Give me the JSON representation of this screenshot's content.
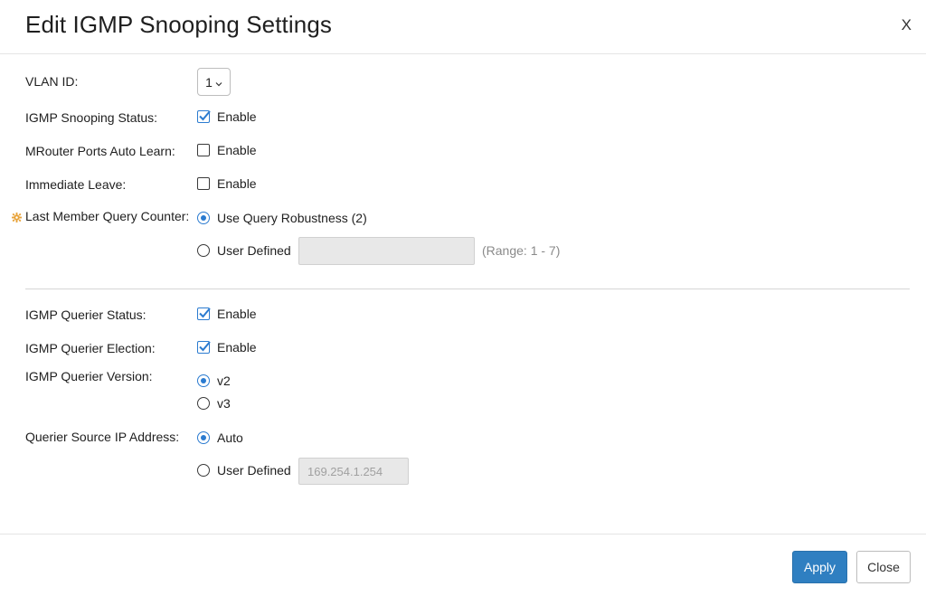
{
  "dialog": {
    "title": "Edit IGMP Snooping Settings",
    "close_glyph": "X"
  },
  "fields": {
    "vlan_id": {
      "label": "VLAN ID:",
      "value": "1"
    },
    "snooping_status": {
      "label": "IGMP Snooping Status:",
      "option": "Enable",
      "checked": true
    },
    "mrouter_auto_learn": {
      "label": "MRouter Ports Auto Learn:",
      "option": "Enable",
      "checked": false
    },
    "immediate_leave": {
      "label": "Immediate Leave:",
      "option": "Enable",
      "checked": false
    },
    "last_member_query_counter": {
      "label": "Last Member Query Counter:",
      "options": [
        {
          "label": "Use Query Robustness (2)",
          "selected": true
        },
        {
          "label": "User Defined",
          "selected": false
        }
      ],
      "user_defined_value": "",
      "range_hint": "(Range: 1 - 7)"
    },
    "querier_status": {
      "label": "IGMP Querier Status:",
      "option": "Enable",
      "checked": true
    },
    "querier_election": {
      "label": "IGMP Querier Election:",
      "option": "Enable",
      "checked": true
    },
    "querier_version": {
      "label": "IGMP Querier Version:",
      "options": [
        {
          "label": "v2",
          "selected": true
        },
        {
          "label": "v3",
          "selected": false
        }
      ]
    },
    "querier_source_ip": {
      "label": "Querier Source IP Address:",
      "options": [
        {
          "label": "Auto",
          "selected": true
        },
        {
          "label": "User Defined",
          "selected": false
        }
      ],
      "user_defined_placeholder": "169.254.1.254"
    }
  },
  "buttons": {
    "apply": "Apply",
    "close": "Close"
  },
  "colors": {
    "accent": "#2b7bd0",
    "apply_bg": "#2f7fc1",
    "gear": "#e8a33a"
  }
}
